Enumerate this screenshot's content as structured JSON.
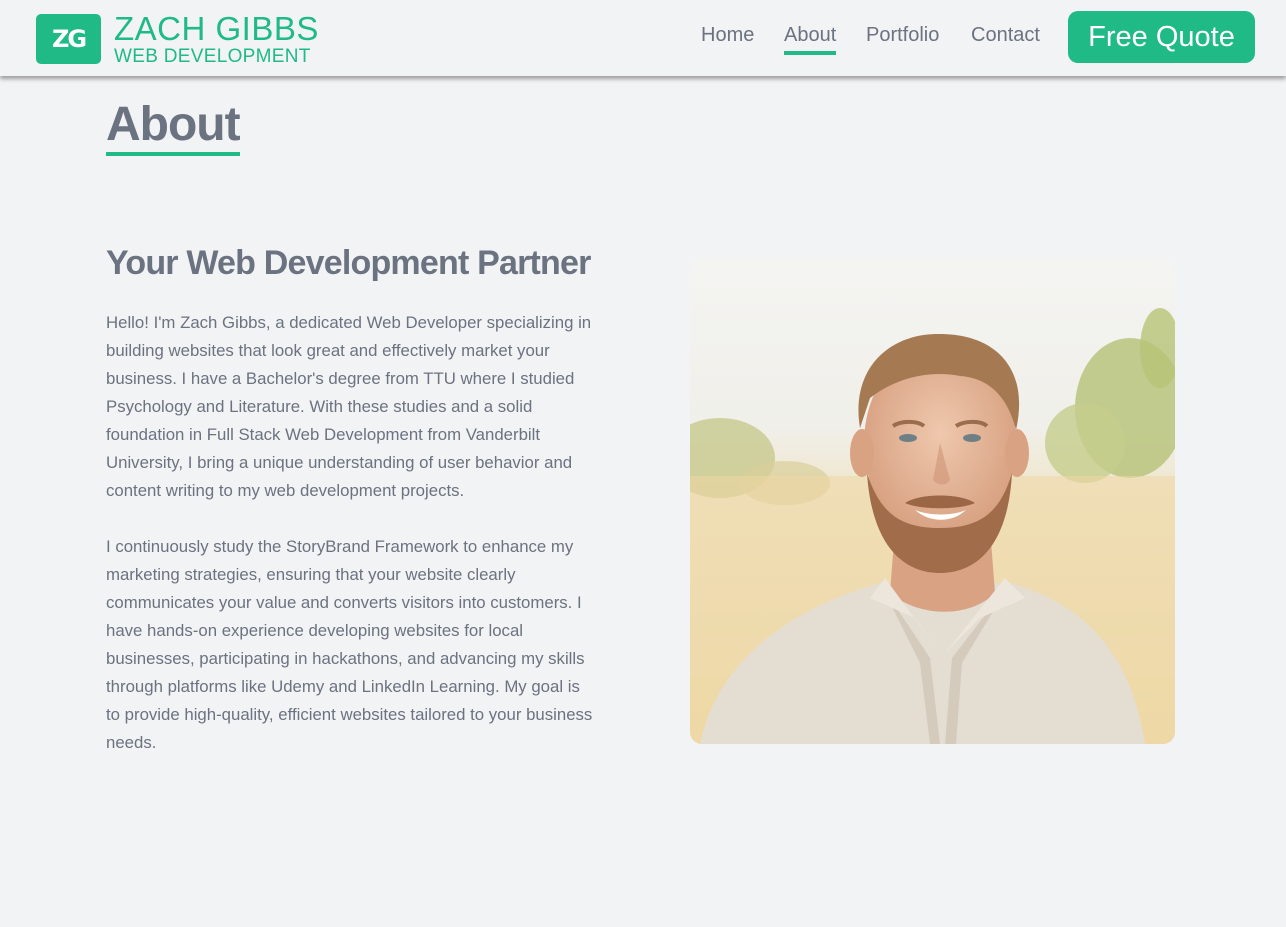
{
  "header": {
    "logo_mark": "ZG",
    "logo_name": "ZACH GIBBS",
    "logo_sub": "WEB DEVELOPMENT",
    "nav": {
      "home": "Home",
      "about": "About",
      "portfolio": "Portfolio",
      "contact": "Contact"
    },
    "cta": "Free Quote"
  },
  "main": {
    "page_title": "About",
    "heading": "Your Web Development Partner",
    "paragraph_1": "Hello! I'm Zach Gibbs, a dedicated Web Developer specializing in building websites that look great and effectively market your business. I have a Bachelor's degree from TTU where I studied Psychology and Literature. With these studies and a solid foundation in Full Stack Web Development from Vanderbilt University, I bring a unique understanding of user behavior and content writing to my web development projects.",
    "paragraph_2": "I continuously study the StoryBrand Framework to enhance my marketing strategies, ensuring that your website clearly communicates your value and converts visitors into customers. I have hands-on experience developing websites for local businesses, participating in hackathons, and advancing my skills through platforms like Udemy and LinkedIn Learning. My goal is to provide high-quality, efficient websites tailored to your business needs."
  },
  "colors": {
    "accent": "#1fba85",
    "text": "#6b7280",
    "background": "#f2f3f5"
  }
}
